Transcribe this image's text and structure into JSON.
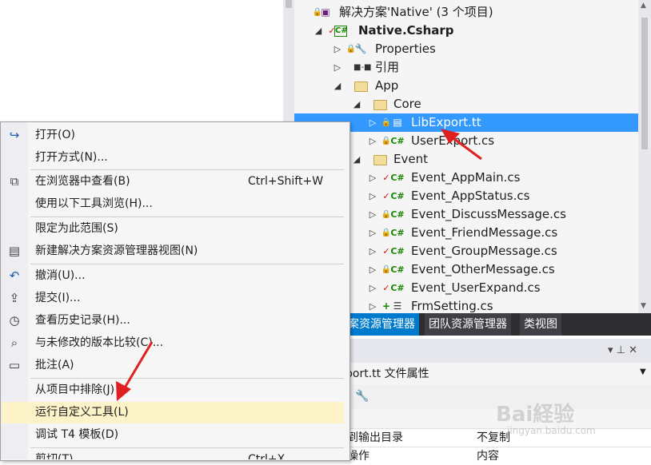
{
  "solution_explorer": {
    "rows": [
      {
        "label": "解决方案'Native' (3 个项目)"
      },
      {
        "label": "Native.Csharp"
      },
      {
        "label": "Properties"
      },
      {
        "label": "引用"
      },
      {
        "label": "App"
      },
      {
        "label": "Core"
      },
      {
        "label": "LibExport.tt"
      },
      {
        "label": "UserExport.cs"
      },
      {
        "label": "Event"
      },
      {
        "label": "Event_AppMain.cs"
      },
      {
        "label": "Event_AppStatus.cs"
      },
      {
        "label": "Event_DiscussMessage.cs"
      },
      {
        "label": "Event_FriendMessage.cs"
      },
      {
        "label": "Event_GroupMessage.cs"
      },
      {
        "label": "Event_OtherMessage.cs"
      },
      {
        "label": "Event_UserExpand.cs"
      },
      {
        "label": "FrmSetting.cs"
      }
    ],
    "csharp_badge": "C#"
  },
  "tabs": {
    "solution": "案资源管理器",
    "team": "团队资源管理器",
    "class": "类视图"
  },
  "properties": {
    "title": "port.tt 文件属性",
    "pin": "▾ ⊥ ✕",
    "rows": [
      {
        "name": "到输出目录",
        "value": "不复制"
      },
      {
        "name": "操作",
        "value": "内容"
      }
    ]
  },
  "context_menu": {
    "items": [
      {
        "label": "打开(O)",
        "shortcut": ""
      },
      {
        "label": "打开方式(N)...",
        "shortcut": ""
      },
      {
        "label": "在浏览器中查看(B)",
        "shortcut": "Ctrl+Shift+W"
      },
      {
        "label": "使用以下工具浏览(H)...",
        "shortcut": ""
      },
      {
        "label": "限定为此范围(S)",
        "shortcut": ""
      },
      {
        "label": "新建解决方案资源管理器视图(N)",
        "shortcut": ""
      },
      {
        "label": "撤消(U)...",
        "shortcut": ""
      },
      {
        "label": "提交(I)...",
        "shortcut": ""
      },
      {
        "label": "查看历史记录(H)...",
        "shortcut": ""
      },
      {
        "label": "与未修改的版本比较(C)...",
        "shortcut": ""
      },
      {
        "label": "批注(A)",
        "shortcut": ""
      },
      {
        "label": "从项目中排除(J)",
        "shortcut": ""
      },
      {
        "label": "运行自定义工具(L)",
        "shortcut": ""
      },
      {
        "label": "调试 T4 模板(D)",
        "shortcut": ""
      },
      {
        "label": "剪切(T)",
        "shortcut": "Ctrl+X"
      }
    ]
  },
  "watermark": {
    "main": "Bai経验",
    "sub": "jingyan.baidu.com"
  }
}
